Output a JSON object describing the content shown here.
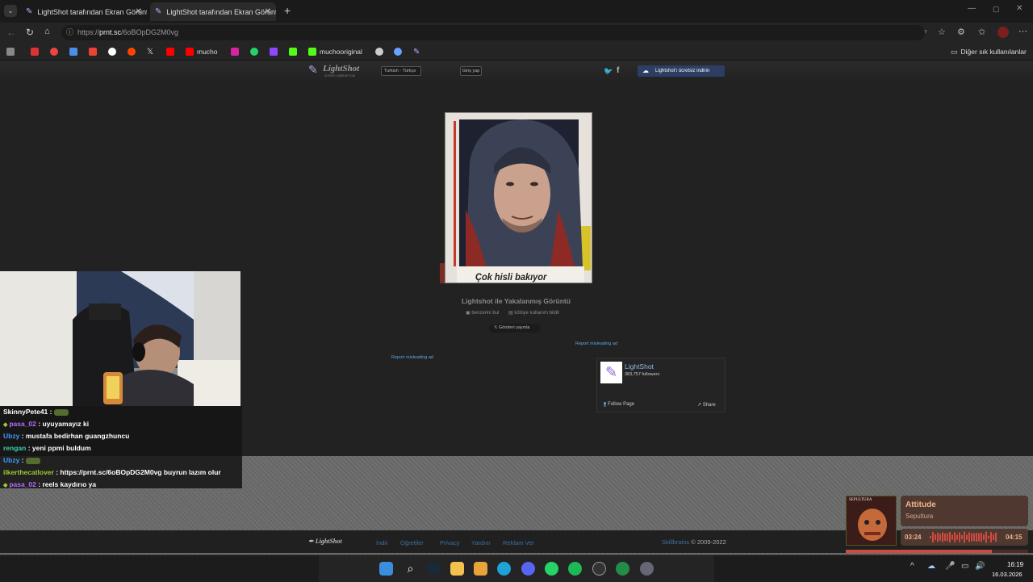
{
  "browser": {
    "tabs": [
      {
        "title": "LightShot tarafından Ekran Görüntü"
      },
      {
        "title": "LightShot tarafından Ekran Görüntü"
      }
    ],
    "url_prefix": "https://",
    "url_host": "prnt.sc",
    "url_path": "/6oBOpDG2M0vg",
    "bookmarks": [
      "mucho",
      "muchooriginal"
    ],
    "other_bookmarks": "Diğer sık kullanılanlar"
  },
  "lightshot": {
    "logo_text": "LightShot",
    "logo_sub": "screen capture tool",
    "language": "Turkish - Türkçe",
    "login": "Giriş yap",
    "download": "Lightshot'ı ücretsiz indirin",
    "caption": "Çok hisli bakıyor",
    "title": "Lightshot ile Yakalanmış Görüntü",
    "find_similar": "benzerini bul",
    "report_abuse": "kötüye kullanım bildir",
    "post_x": "Gönderi yayınla",
    "report_ad_1": "Report misleading ad",
    "report_ad_2": "Report misleading ad",
    "fb": {
      "name": "LightShot",
      "followers": "383,757 followers",
      "follow": "Follow Page",
      "share": "Share"
    },
    "footer": {
      "logo": "LightShot",
      "links": [
        "İndir",
        "Öğretiler",
        "Privacy",
        "Yardım",
        "Reklam Ver"
      ],
      "brand": "Skillbrains",
      "copyright": "© 2009-2022"
    }
  },
  "chat": [
    {
      "user": "SkinnyPete41",
      "text": "",
      "color": "#ffffff"
    },
    {
      "user": "pasa_02",
      "text": "uyuyamayız ki",
      "color": "#b46cff"
    },
    {
      "user": "Ubzy",
      "text": "mustafa bedirhan guangzhuncu",
      "color": "#3a9bff"
    },
    {
      "user": "rengan",
      "text": "yeni ppmi buldum",
      "color": "#36d3a6"
    },
    {
      "user": "Ubzy",
      "text": "",
      "color": "#3a9bff"
    },
    {
      "user": "ilkerthecatlover",
      "text": "https://prnt.sc/6oBOpDG2M0vg buyrun lazım olur",
      "color": "#9acd32"
    },
    {
      "user": "pasa_02",
      "text": "reels kaydırıo ya",
      "color": "#b46cff"
    }
  ],
  "music": {
    "album": "SEPULTURA",
    "track": "Attitude",
    "artist": "Sepultura",
    "elapsed": "03:24",
    "total": "04:15",
    "progress": 0.8
  },
  "taskbar": {
    "time": "16:19",
    "date": "16.03.2026"
  }
}
